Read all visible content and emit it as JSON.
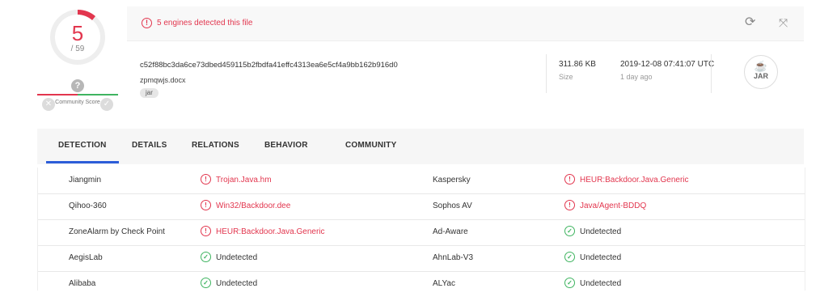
{
  "score": {
    "detections": "5",
    "total": "/ 59",
    "community_label": "Community Score",
    "qmark": "?"
  },
  "alert": {
    "text": "5 engines detected this file"
  },
  "file": {
    "hash": "c52f88bc3da6ce73dbed459115b2fbdfa41effc4313ea6e5cf4a9bb162b916d0",
    "name": "zpmqwjs.docx",
    "tag": "jar",
    "size_value": "311.86 KB",
    "size_label": "Size",
    "date_value": "2019-12-08 07:41:07 UTC",
    "date_ago": "1 day ago",
    "type_badge": "JAR"
  },
  "tabs": [
    {
      "label": "DETECTION",
      "active": true
    },
    {
      "label": "DETAILS"
    },
    {
      "label": "RELATIONS"
    },
    {
      "label": "BEHAVIOR"
    },
    {
      "label": "COMMUNITY"
    }
  ],
  "detections": [
    {
      "left": {
        "engine": "Jiangmin",
        "result": "Trojan.Java.hm",
        "status": "malicious"
      },
      "right": {
        "engine": "Kaspersky",
        "result": "HEUR:Backdoor.Java.Generic",
        "status": "malicious"
      }
    },
    {
      "left": {
        "engine": "Qihoo-360",
        "result": "Win32/Backdoor.dee",
        "status": "malicious"
      },
      "right": {
        "engine": "Sophos AV",
        "result": "Java/Agent-BDDQ",
        "status": "malicious"
      }
    },
    {
      "left": {
        "engine": "ZoneAlarm by Check Point",
        "result": "HEUR:Backdoor.Java.Generic",
        "status": "malicious"
      },
      "right": {
        "engine": "Ad-Aware",
        "result": "Undetected",
        "status": "clean"
      }
    },
    {
      "left": {
        "engine": "AegisLab",
        "result": "Undetected",
        "status": "clean"
      },
      "right": {
        "engine": "AhnLab-V3",
        "result": "Undetected",
        "status": "clean"
      }
    },
    {
      "left": {
        "engine": "Alibaba",
        "result": "Undetected",
        "status": "clean"
      },
      "right": {
        "engine": "ALYac",
        "result": "Undetected",
        "status": "clean"
      }
    }
  ],
  "colors": {
    "malicious": "#e2364e",
    "clean": "#3fb460",
    "accent": "#2c5dd8"
  }
}
